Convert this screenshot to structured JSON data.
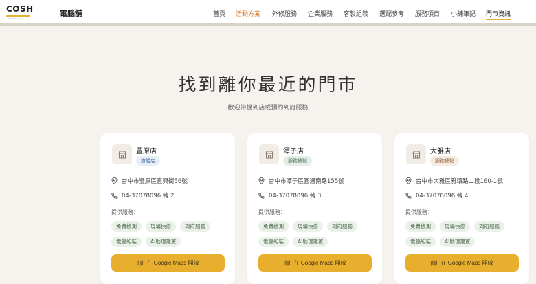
{
  "header": {
    "logo_text": "COSH",
    "logo_sub": "computer shop",
    "brand_name": "電腦舖",
    "nav": [
      {
        "label": "首頁"
      },
      {
        "label": "活動方案"
      },
      {
        "label": "外修服務"
      },
      {
        "label": "企業服務"
      },
      {
        "label": "客製組裝"
      },
      {
        "label": "選配參考"
      },
      {
        "label": "服務項目"
      },
      {
        "label": "小舖筆記"
      },
      {
        "label": "門市資訊"
      }
    ]
  },
  "hero": {
    "title": "找到離你最近的門市",
    "subtitle": "歡迎帶機到店或預約到府服務"
  },
  "stores": [
    {
      "name": "豐原店",
      "badge": "旗艦店",
      "badge_type": "flag",
      "address": "台中市豐原區直興街56號",
      "phone": "04-37078096 轉 2",
      "services_label": "提供服務：",
      "services": [
        "免費檢測",
        "現場快修",
        "到府服務",
        "電腦組裝",
        "AI助理建置"
      ],
      "maps_button": "在 Google Maps 開啟"
    },
    {
      "name": "潭子店",
      "badge": "服務據點",
      "badge_type": "service",
      "address": "台中市潭子區圓通南路155號",
      "phone": "04-37078096 轉 3",
      "services_label": "提供服務：",
      "services": [
        "免費檢測",
        "現場快修",
        "到府服務",
        "電腦組裝",
        "AI助理建置"
      ],
      "maps_button": "在 Google Maps 開啟"
    },
    {
      "name": "大雅店",
      "badge": "服務據點",
      "badge_type": "point",
      "address": "台中市大雅區雅環路二段160-1號",
      "phone": "04-37078096 轉 4",
      "services_label": "提供服務：",
      "services": [
        "免費檢測",
        "現場快修",
        "到府服務",
        "電腦組裝",
        "AI助理建置"
      ],
      "maps_button": "在 Google Maps 開啟"
    }
  ],
  "colors": {
    "accent": "#e8ae2e",
    "active_nav": "#d9782a",
    "page_bg": "#f6f3ee"
  }
}
